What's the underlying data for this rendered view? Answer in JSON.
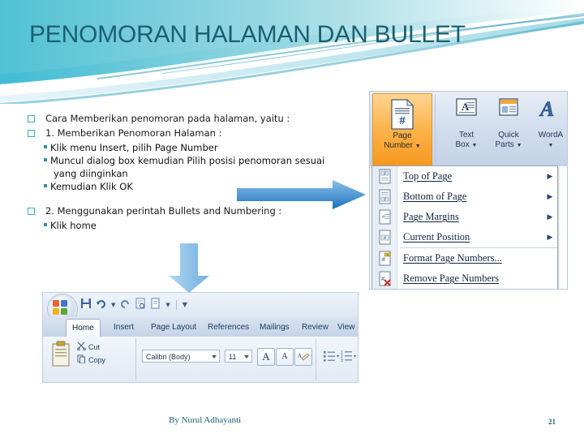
{
  "slide": {
    "title": "PENOMORAN HALAMAN DAN BULLET",
    "title_color": "#1b5f72",
    "accent_color": "#3aacbe"
  },
  "body": {
    "lines": [
      {
        "level": 1,
        "text": "Cara Memberikan penomoran pada halaman, yaitu :"
      },
      {
        "level": 1,
        "text": "1. Memberikan Penomoran Halaman :"
      },
      {
        "level": 2,
        "text": "Klik menu Insert, pilih Page Number"
      },
      {
        "level": 2,
        "text": "Muncul dialog box kemudian Pilih posisi penomoran sesuai"
      },
      {
        "level": 2,
        "text": "yang diinginkan",
        "continuation": true
      },
      {
        "level": 2,
        "text": "Kemudian Klik OK"
      },
      {
        "level": 1,
        "text": "2. Menggunakan perintah Bullets and Numbering :"
      },
      {
        "level": 2,
        "text": "Klik home"
      }
    ]
  },
  "arrows": {
    "right_arrow_name": "right-arrow-shape",
    "down_arrow_name": "down-arrow-shape",
    "right_color": "#4b93d1",
    "down_color": "#9dc8ec"
  },
  "word_ribbon_top": {
    "page_number_button": {
      "label_line1": "Page",
      "label_line2": "Number",
      "highlight_color": "#f5991f"
    },
    "ribbon_items": [
      {
        "label_line1": "Text",
        "label_line2": "Box"
      },
      {
        "label_line1": "Quick",
        "label_line2": "Parts"
      },
      {
        "label_line1": "WordA",
        "label_line2": ""
      }
    ],
    "menu_items": [
      {
        "label": "Top of Page",
        "submenu": true
      },
      {
        "label": "Bottom of Page",
        "submenu": true
      },
      {
        "label": "Page Margins",
        "submenu": true
      },
      {
        "label": "Current Position",
        "submenu": true
      },
      {
        "label": "Format Page Numbers...",
        "submenu": false
      },
      {
        "label": "Remove Page Numbers",
        "submenu": false
      }
    ]
  },
  "word_ribbon_bottom": {
    "tabs": [
      {
        "label": "Home",
        "active": true
      },
      {
        "label": "Insert",
        "active": false
      },
      {
        "label": "Page Layout",
        "active": false
      },
      {
        "label": "References",
        "active": false
      },
      {
        "label": "Mailings",
        "active": false
      },
      {
        "label": "Review",
        "active": false
      },
      {
        "label": "View",
        "active": false
      }
    ],
    "clipboard": {
      "cut_label": "Cut",
      "copy_label": "Copy"
    },
    "font_name": "Calibri (Body)",
    "font_size": "11",
    "grow_font": "A",
    "shrink_font": "A"
  },
  "footer": {
    "author": "By Nurul Adhayanti",
    "page_number": "21"
  }
}
